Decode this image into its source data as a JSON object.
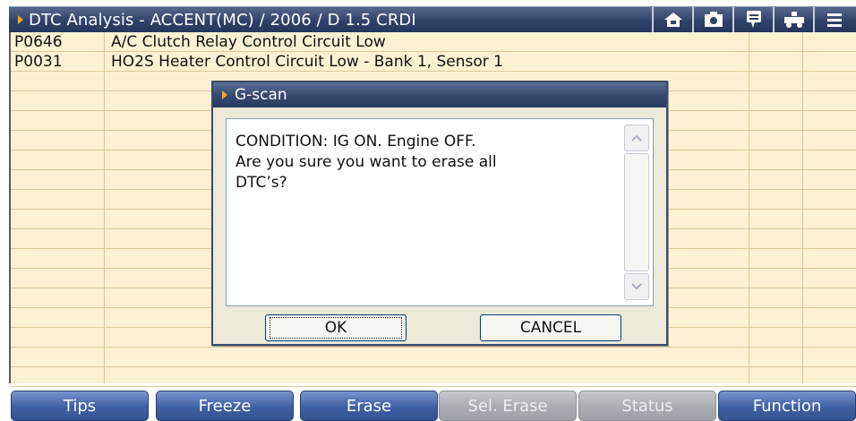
{
  "header": {
    "title": "DTC Analysis - ACCENT(MC) / 2006 / D 1.5 CRDI",
    "icons": [
      "home-icon",
      "camera-icon",
      "comment-icon",
      "vehicle-icon",
      "menu-icon"
    ]
  },
  "dtc_list": {
    "rows": [
      {
        "code": "P0646",
        "description": "A/C Clutch Relay Control Circuit Low"
      },
      {
        "code": "P0031",
        "description": "HO2S Heater Control Circuit Low - Bank 1, Sensor 1"
      }
    ]
  },
  "dialog": {
    "title": "G-scan",
    "message_lines": [
      "CONDITION: IG ON. Engine OFF.",
      "",
      "Are you sure you want to erase all",
      "DTC’s?"
    ],
    "ok_label": "OK",
    "cancel_label": "CANCEL"
  },
  "function_bar": {
    "buttons": [
      {
        "label": "Tips",
        "enabled": true
      },
      {
        "label": "Freeze",
        "enabled": true
      },
      {
        "label": "Erase",
        "enabled": true
      },
      {
        "label": "Sel. Erase",
        "enabled": false
      },
      {
        "label": "Status",
        "enabled": false
      },
      {
        "label": "Function",
        "enabled": true
      }
    ]
  },
  "colors": {
    "title_bar": "#2f4368",
    "grid_background": "#fdf1d3",
    "accent_arrow": "#f5a623",
    "button_blue": "#3f5fa6",
    "button_disabled": "#a9acb2"
  }
}
